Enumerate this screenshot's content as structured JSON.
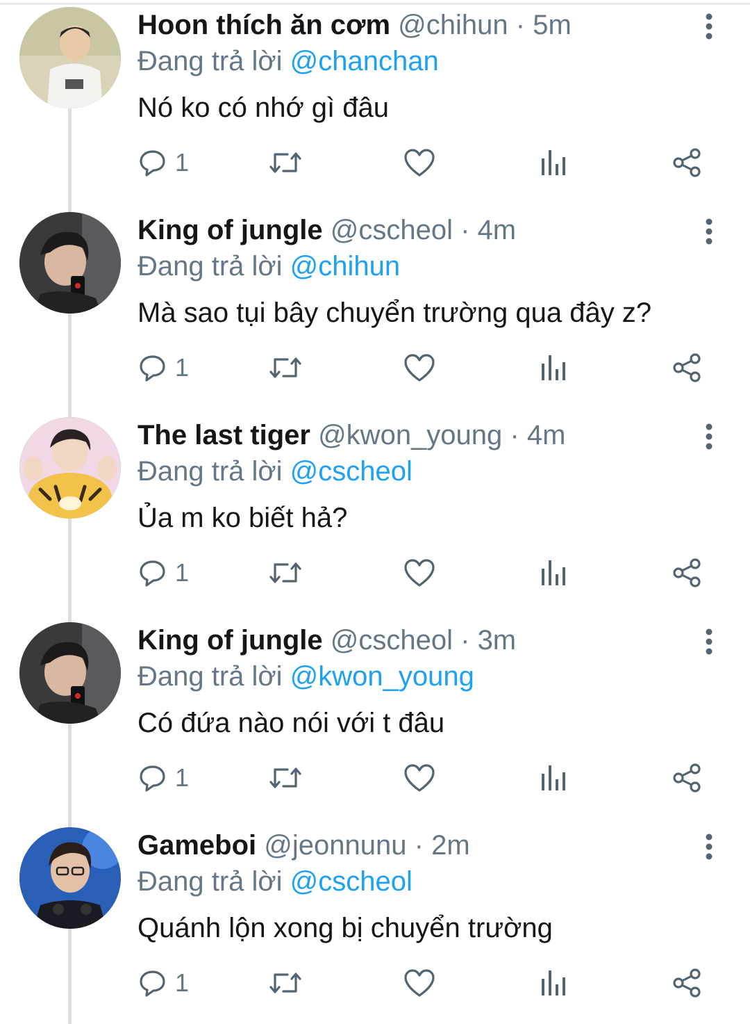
{
  "replying_prefix": "Đang trả lời",
  "separator": "·",
  "tweets": [
    {
      "name": "Hoon thích ăn cơm",
      "handle": "@chihun",
      "time": "5m",
      "reply_to": "@chanchan",
      "text": "Nó ko có nhớ gì đâu",
      "reply_count": "1",
      "avatar_icon": "user-avatar-photo"
    },
    {
      "name": "King of jungle",
      "handle": "@cscheol",
      "time": "4m",
      "reply_to": "@chihun",
      "text": "Mà sao tụi bây chuyển trường qua đây z?",
      "reply_count": "1",
      "avatar_icon": "user-avatar-photo"
    },
    {
      "name": "The last tiger",
      "handle": "@kwon_young",
      "time": "4m",
      "reply_to": "@cscheol",
      "text": "Ủa m ko biết hả?",
      "reply_count": "1",
      "avatar_icon": "user-avatar-photo"
    },
    {
      "name": "King of jungle",
      "handle": "@cscheol",
      "time": "3m",
      "reply_to": "@kwon_young",
      "text": "Có đứa nào nói với t đâu",
      "reply_count": "1",
      "avatar_icon": "user-avatar-photo"
    },
    {
      "name": "Gameboi",
      "handle": "@jeonnunu",
      "time": "2m",
      "reply_to": "@cscheol",
      "text": "Quánh lộn xong bị chuyển trường",
      "reply_count": "1",
      "avatar_icon": "user-avatar-photo"
    }
  ],
  "icons": {
    "reply": "reply-icon",
    "retweet": "retweet-icon",
    "like": "heart-icon",
    "stats": "stats-icon",
    "share": "share-icon",
    "more": "more-vertical-icon"
  },
  "colors": {
    "name": "#14171a",
    "secondary": "#657786",
    "mention": "#1da1f2",
    "thread_line": "#dcdcdc"
  }
}
